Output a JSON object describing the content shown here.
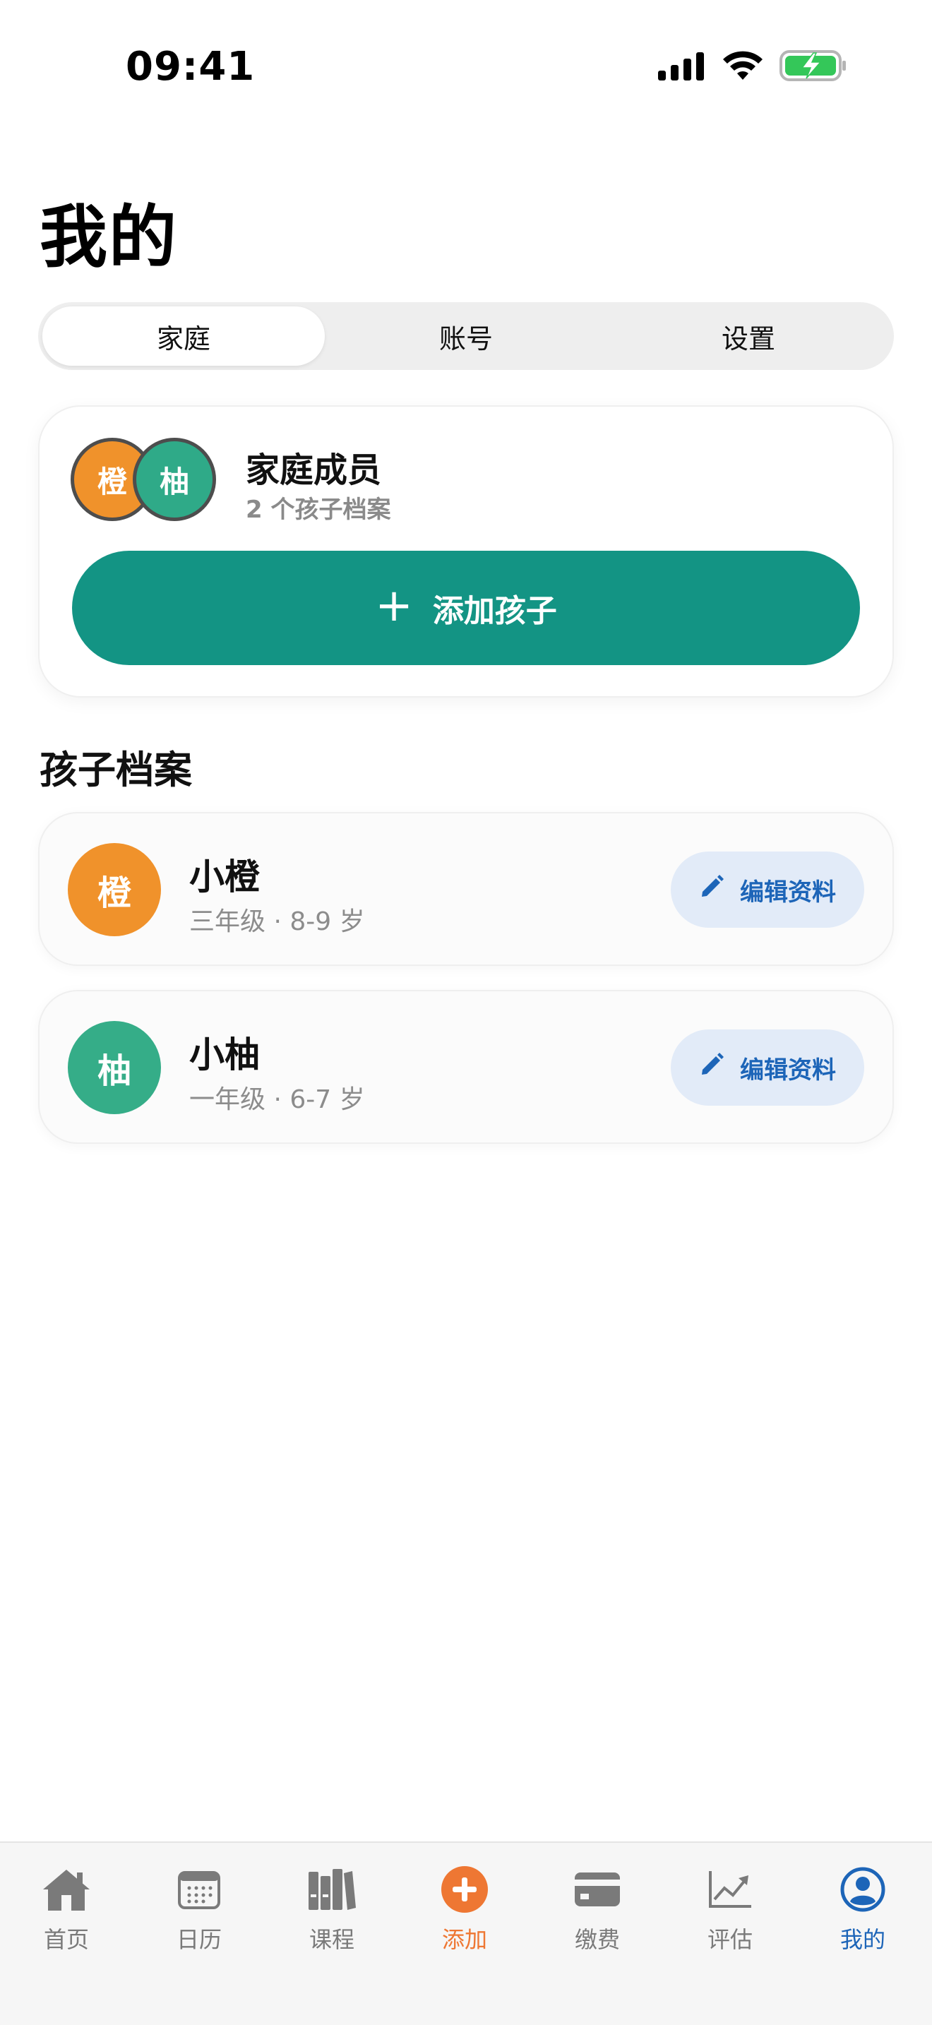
{
  "status_bar": {
    "time": "09:41",
    "icons": [
      "cellular-signal-icon",
      "wifi-icon",
      "battery-charging-icon"
    ]
  },
  "page": {
    "title": "我的"
  },
  "segmented_tabs": [
    {
      "label": "家庭",
      "active": true
    },
    {
      "label": "账号",
      "active": false
    },
    {
      "label": "设置",
      "active": false
    }
  ],
  "family_card": {
    "avatars": [
      "橙",
      "柚"
    ],
    "title": "家庭成员",
    "subtitle": "2 个孩子档案",
    "add_button_label": "添加孩子",
    "add_button_icon": "plus-icon"
  },
  "section": {
    "title": "孩子档案"
  },
  "children": [
    {
      "avatar": "橙",
      "name": "小橙",
      "meta": "三年级 · 8-9 岁",
      "edit_label": "编辑资料",
      "color": "#f0922b"
    },
    {
      "avatar": "柚",
      "name": "小柚",
      "meta": "一年级 · 6-7 岁",
      "edit_label": "编辑资料",
      "color": "#35ad88"
    }
  ],
  "tab_bar": {
    "items": [
      {
        "label": "首页",
        "icon": "house-icon"
      },
      {
        "label": "日历",
        "icon": "calendar-icon"
      },
      {
        "label": "课程",
        "icon": "books-icon"
      },
      {
        "label": "添加",
        "icon": "add-circle-icon"
      },
      {
        "label": "缴费",
        "icon": "credit-card-icon"
      },
      {
        "label": "评估",
        "icon": "trend-chart-icon"
      },
      {
        "label": "我的",
        "icon": "profile-icon",
        "active": true
      }
    ]
  },
  "colors": {
    "primary_teal": "#139484",
    "accent_orange": "#ee7733",
    "active_blue": "#1d65b8",
    "edit_button_bg": "#e2ebf8"
  }
}
